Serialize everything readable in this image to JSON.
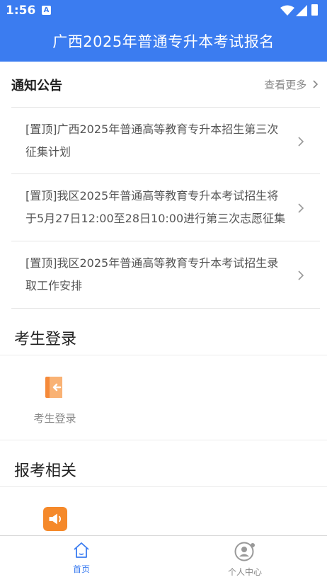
{
  "status_bar": {
    "time": "1:56",
    "notification_icon": "A"
  },
  "header": {
    "title": "广西2025年普通专升本考试报名"
  },
  "notices": {
    "title": "通知公告",
    "more_label": "查看更多",
    "items": [
      {
        "label": "[置顶]广西2025年普通高等教育专升本招生第三次征集计划"
      },
      {
        "label": "[置顶]我区2025年普通高等教育专升本考试招生将于5月27日12:00至28日10:00进行第三次志愿征集"
      },
      {
        "label": "[置顶]我区2025年普通高等教育专升本考试招生录取工作安排"
      }
    ]
  },
  "login_section": {
    "title": "考生登录",
    "tile_label": "考生登录"
  },
  "exam_section": {
    "title": "报考相关"
  },
  "bottom_nav": {
    "home_label": "首页",
    "profile_label": "个人中心"
  },
  "colors": {
    "primary": "#3b7cf0",
    "login_icon": "#f58a3a",
    "announce_icon": "#f5892a"
  }
}
